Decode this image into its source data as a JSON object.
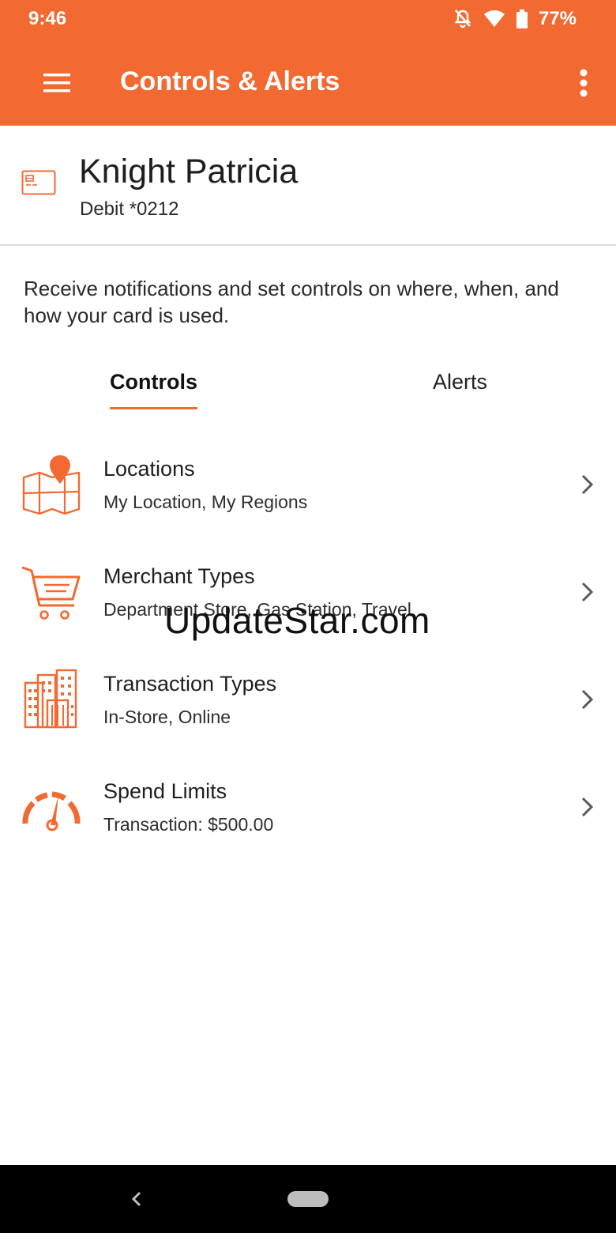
{
  "status_bar": {
    "time": "9:46",
    "battery_percent": "77%",
    "icons": [
      "notifications-off-icon",
      "wifi-icon",
      "battery-icon"
    ]
  },
  "app_bar": {
    "title": "Controls & Alerts",
    "menu_icon": "hamburger-menu-icon",
    "overflow_icon": "more-vertical-icon",
    "background_color": "#F26A32"
  },
  "card": {
    "name": "Knight Patricia",
    "subtitle": "Debit *0212",
    "icon": "credit-card-icon"
  },
  "description": "Receive notifications and set controls on where, when, and how your card is used.",
  "tabs": {
    "items": [
      {
        "label": "Controls",
        "selected": true
      },
      {
        "label": "Alerts",
        "selected": false
      }
    ]
  },
  "controls": {
    "items": [
      {
        "title": "Locations",
        "subtitle": "My Location, My Regions",
        "icon": "map-pin-icon"
      },
      {
        "title": "Merchant Types",
        "subtitle": "Department Store, Gas Station, Travel",
        "icon": "shopping-cart-icon"
      },
      {
        "title": "Transaction Types",
        "subtitle": "In-Store, Online",
        "icon": "buildings-icon"
      },
      {
        "title": "Spend Limits",
        "subtitle": "Transaction: $500.00",
        "icon": "gauge-icon"
      }
    ]
  },
  "watermark": "UpdateStar.com",
  "colors": {
    "accent": "#F26A32",
    "text": "#1f1f1f"
  }
}
